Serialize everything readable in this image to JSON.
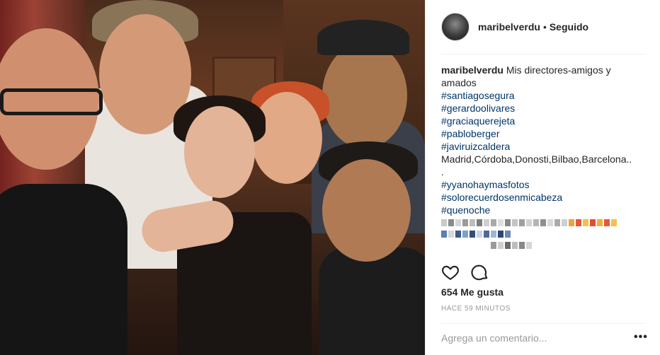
{
  "post": {
    "image_alt": "",
    "username": "maribelverdu",
    "separator": "•",
    "follow_status": "Seguido"
  },
  "caption": {
    "username": "maribelverdu",
    "text": " Mis directores-amigos y amados",
    "hashtags_1": [
      "#santiagosegura",
      "#gerardoolivares",
      "#graciaquerejeta",
      "#pabloberger",
      "#javiruizcaldera"
    ],
    "places": "Madrid,Córdoba,Donosti,Bilbao,Barcelona..",
    "places_end": ".",
    "hashtags_2": [
      "#yyanohaymasfotos",
      "#solorecuerdosenmicabeza",
      "#quenoche"
    ]
  },
  "actions": {
    "like_icon": "heart-icon",
    "comment_icon": "comment-bubble-icon"
  },
  "likes_text": "654 Me gusta",
  "timestamp": "HACE 59 MINUTOS",
  "comment": {
    "placeholder": "Agrega un comentario...",
    "more_label": "•••"
  },
  "colors": {
    "hashtag": "#003569",
    "text": "#262626",
    "muted": "#999999",
    "divider": "#efefef"
  }
}
